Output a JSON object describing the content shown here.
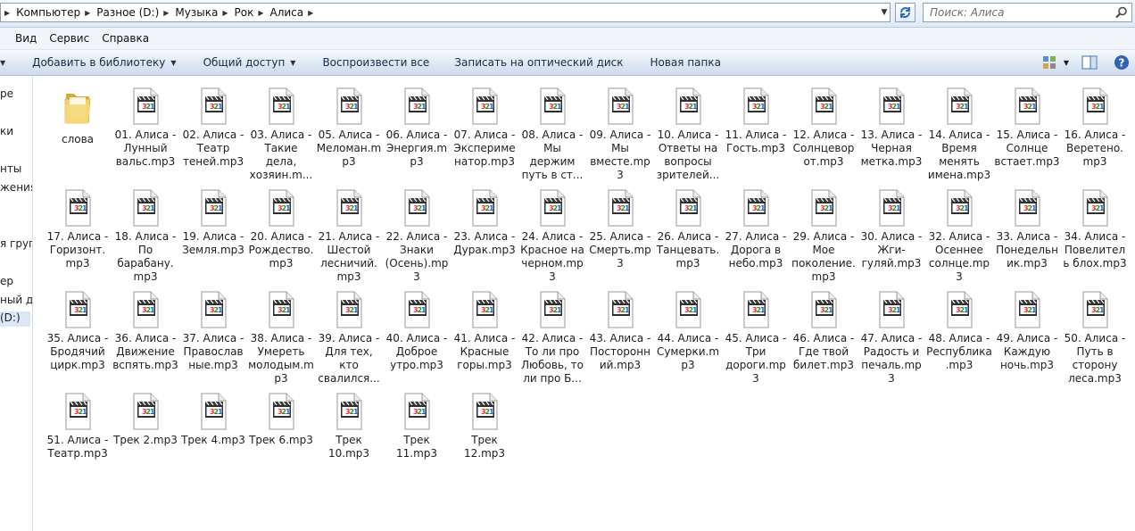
{
  "address": {
    "crumbs": [
      "Компьютер",
      "Разное (D:)",
      "Музыка",
      "Рок",
      "Алиса"
    ]
  },
  "search": {
    "placeholder": "Поиск: Алиса"
  },
  "menu": [
    "Вид",
    "Сервис",
    "Справка"
  ],
  "commands": {
    "library": "Добавить в библиотеку",
    "share": "Общий доступ",
    "play_all": "Воспроизвести все",
    "burn": "Записать на оптический диск",
    "new_folder": "Новая папка"
  },
  "nav": [
    {
      "label": "ре"
    },
    {
      "label": "ки"
    },
    {
      "label": "нты"
    },
    {
      "label": "жения"
    },
    {
      "label": "я груп"
    },
    {
      "label": "ер"
    },
    {
      "label": "ный ди"
    },
    {
      "label": "(D:)"
    }
  ],
  "items": [
    {
      "type": "folder",
      "label": "слова"
    },
    {
      "type": "media",
      "label": "01. Алиса - Лунный вальс.mp3"
    },
    {
      "type": "media",
      "label": "02. Алиса - Театр теней.mp3"
    },
    {
      "type": "media",
      "label": "03. Алиса - Такие дела, хозяин.m..."
    },
    {
      "type": "media",
      "label": "05. Алиса - Меломан.mp3"
    },
    {
      "type": "media",
      "label": "06. Алиса - Энергия.mp3"
    },
    {
      "type": "media",
      "label": "07. Алиса - Эксперименатор.mp3"
    },
    {
      "type": "media",
      "label": "08. Алиса - Мы держим путь в ст..."
    },
    {
      "type": "media",
      "label": "09. Алиса - Мы вместе.mp3"
    },
    {
      "type": "media",
      "label": "10. Алиса - Ответы на вопросы зрителей...."
    },
    {
      "type": "media",
      "label": "11. Алиса - Гость.mp3"
    },
    {
      "type": "media",
      "label": "12. Алиса - Солнцеворот.mp3"
    },
    {
      "type": "media",
      "label": "13. Алиса - Черная метка.mp3"
    },
    {
      "type": "media",
      "label": "14. Алиса - Время менять имена.mp3"
    },
    {
      "type": "media",
      "label": "15. Алиса - Солнце встает.mp3"
    },
    {
      "type": "media",
      "label": "16. Алиса - Веретено.mp3"
    },
    {
      "type": "media",
      "label": "17. Алиса - Горизонт.mp3"
    },
    {
      "type": "media",
      "label": "18. Алиса - По барабану.mp3"
    },
    {
      "type": "media",
      "label": "19. Алиса - Земля.mp3"
    },
    {
      "type": "media",
      "label": "20. Алиса - Рождество.mp3"
    },
    {
      "type": "media",
      "label": "21. Алиса - Шестой лесничий.mp3"
    },
    {
      "type": "media",
      "label": "22. Алиса - Знаки (Осень).mp3"
    },
    {
      "type": "media",
      "label": "23. Алиса - Дурак.mp3"
    },
    {
      "type": "media",
      "label": "24. Алиса - Красное на черном.mp3"
    },
    {
      "type": "media",
      "label": "25. Алиса - Смерть.mp3"
    },
    {
      "type": "media",
      "label": "26. Алиса - Танцевать.mp3"
    },
    {
      "type": "media",
      "label": "27. Алиса - Дорога в небо.mp3"
    },
    {
      "type": "media",
      "label": "29. Алиса - Мое поколение.mp3"
    },
    {
      "type": "media",
      "label": "30. Алиса - Жги-гуляй.mp3"
    },
    {
      "type": "media",
      "label": "32. Алиса - Осеннее солнце.mp3"
    },
    {
      "type": "media",
      "label": "33. Алиса - Понедельник.mp3"
    },
    {
      "type": "media",
      "label": "34. Алиса - Повелитель блох.mp3"
    },
    {
      "type": "media",
      "label": "35. Алиса - Бродячий цирк.mp3"
    },
    {
      "type": "media",
      "label": "36. Алиса - Движение вспять.mp3"
    },
    {
      "type": "media",
      "label": "37. Алиса - Православные.mp3"
    },
    {
      "type": "media",
      "label": "38. Алиса - Умереть молодым.mp3"
    },
    {
      "type": "media",
      "label": "39. Алиса - Для тех, кто свалился..."
    },
    {
      "type": "media",
      "label": "40. Алиса - Доброе утро.mp3"
    },
    {
      "type": "media",
      "label": "41. Алиса - Красные горы.mp3"
    },
    {
      "type": "media",
      "label": "42. Алиса - То ли про Любовь, то ли про Б..."
    },
    {
      "type": "media",
      "label": "43. Алиса - Посторонний.mp3"
    },
    {
      "type": "media",
      "label": "44. Алиса - Сумерки.mp3"
    },
    {
      "type": "media",
      "label": "45. Алиса - Три дороги.mp3"
    },
    {
      "type": "media",
      "label": "46. Алиса - Где твой билет.mp3"
    },
    {
      "type": "media",
      "label": "47. Алиса - Радость и печаль.mp3"
    },
    {
      "type": "media",
      "label": "48. Алиса - Республика.mp3"
    },
    {
      "type": "media",
      "label": "49. Алиса - Каждую ночь.mp3"
    },
    {
      "type": "media",
      "label": "50. Алиса - Путь в сторону леса.mp3"
    },
    {
      "type": "media",
      "label": "51. Алиса - Театр.mp3"
    },
    {
      "type": "media",
      "label": "Трек 2.mp3"
    },
    {
      "type": "media",
      "label": "Трек 4.mp3"
    },
    {
      "type": "media",
      "label": "Трек 6.mp3"
    },
    {
      "type": "media",
      "label": "Трек 10.mp3"
    },
    {
      "type": "media",
      "label": "Трек 11.mp3"
    },
    {
      "type": "media",
      "label": "Трек 12.mp3"
    }
  ]
}
